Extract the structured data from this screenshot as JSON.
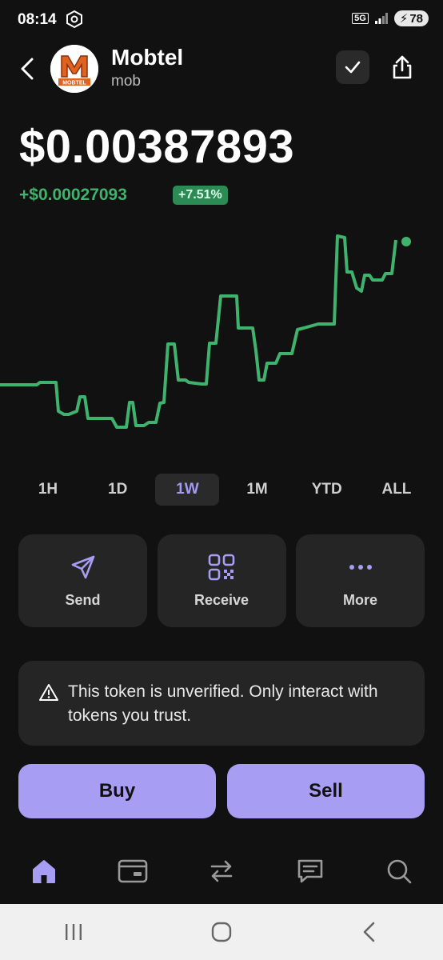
{
  "status": {
    "time": "08:14",
    "network": "5G",
    "battery": "78"
  },
  "token": {
    "name": "Mobtel",
    "symbol": "mob",
    "logo_text": "MOBTEL",
    "price": "$0.00387893",
    "change_abs": "+$0.00027093",
    "change_pct": "+7.51%"
  },
  "colors": {
    "accent": "#a79df2",
    "positive": "#3fb36d",
    "background": "#111111",
    "card": "#252525"
  },
  "ranges": [
    {
      "label": "1H",
      "active": false
    },
    {
      "label": "1D",
      "active": false
    },
    {
      "label": "1W",
      "active": true
    },
    {
      "label": "1M",
      "active": false
    },
    {
      "label": "YTD",
      "active": false
    },
    {
      "label": "ALL",
      "active": false
    }
  ],
  "actions": {
    "send": {
      "label": "Send",
      "icon": "send-icon"
    },
    "receive": {
      "label": "Receive",
      "icon": "qr-code-icon"
    },
    "more": {
      "label": "More",
      "icon": "more-dots-icon"
    }
  },
  "warning": {
    "text": "This token is unverified. Only interact with tokens you trust.",
    "icon": "warning-triangle-icon"
  },
  "buttons": {
    "buy": "Buy",
    "sell": "Sell"
  },
  "nav": [
    "home-icon",
    "wallet-icon",
    "swap-icon",
    "chat-icon",
    "search-icon"
  ]
}
